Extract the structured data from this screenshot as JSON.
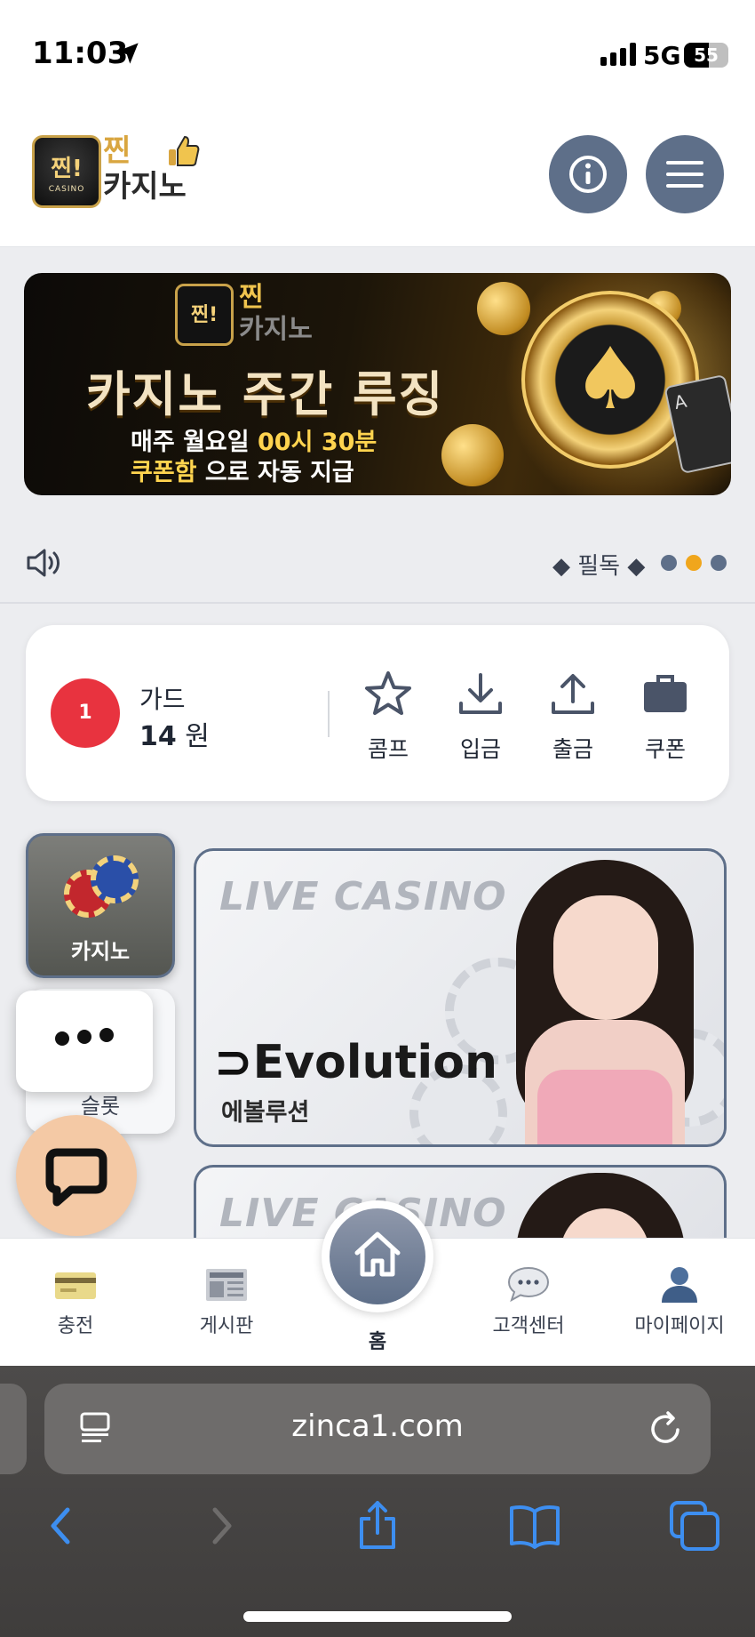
{
  "status_bar": {
    "time": "11:03",
    "network": "5G",
    "battery": "55",
    "battery_level_percent": 55
  },
  "header": {
    "logo_top": "찐!",
    "logo_badge_sub": "CASINO",
    "logo_line1": "찐",
    "logo_line2": "카지노",
    "info_button_icon": "info-icon",
    "menu_button_icon": "hamburger-menu-icon"
  },
  "banner": {
    "logo_top": "찐!",
    "logo_line1": "찐",
    "logo_line2": "카지노",
    "title": "카지노 주간 루징",
    "sub_line1_a": "매주 월요일 ",
    "sub_line1_b": "00시 30분",
    "sub_line2_a": "쿠폰함",
    "sub_line2_b": " 으로 자동 지급",
    "card_rank": "A"
  },
  "notice": {
    "text": "◆ 필독 ◆",
    "slide_count": 3,
    "active_slide": 2
  },
  "account": {
    "level": "1",
    "name": "가드",
    "balance": "14",
    "currency": "원",
    "actions": [
      {
        "label": "콤프",
        "icon": "star-icon"
      },
      {
        "label": "입금",
        "icon": "download-icon"
      },
      {
        "label": "출금",
        "icon": "upload-icon"
      },
      {
        "label": "쿠폰",
        "icon": "briefcase-icon"
      }
    ]
  },
  "categories": [
    {
      "label": "카지노",
      "active": true
    },
    {
      "label": "슬롯",
      "active": false
    }
  ],
  "games": [
    {
      "title": "LIVE CASINO",
      "brand": "Evolution",
      "brand_ko": "에볼루션"
    },
    {
      "title": "LIVE CASINO"
    }
  ],
  "bottom_nav": {
    "items": [
      {
        "label": "충전",
        "icon": "credit-card-icon"
      },
      {
        "label": "게시판",
        "icon": "newspaper-icon"
      },
      {
        "label": "홈",
        "icon": "home-icon"
      },
      {
        "label": "고객센터",
        "icon": "chat-bubble-icon"
      },
      {
        "label": "마이페이지",
        "icon": "user-icon"
      }
    ]
  },
  "browser": {
    "url": "zinca1.com"
  },
  "colors": {
    "accent": "#5e6f89",
    "badge_red": "#e8333f",
    "dot_active": "#f0a61c",
    "chat_fab": "#f4c9a5",
    "ios_blue": "#3d8ef0"
  }
}
